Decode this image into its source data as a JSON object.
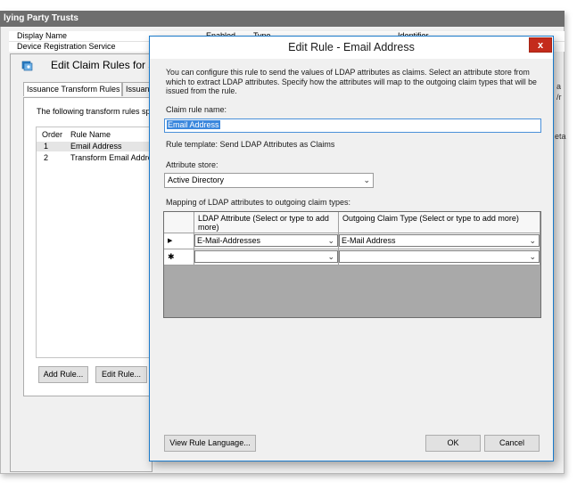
{
  "background_window": {
    "title": "lying Party Trusts",
    "columns": [
      "Display Name",
      "Enabled",
      "Type",
      "Identifier"
    ],
    "row": "Device Registration Service",
    "edge_texts": [
      "a",
      "/r",
      "eta"
    ]
  },
  "edit_claim_rules": {
    "title": "Edit Claim Rules for s",
    "tabs": [
      "Issuance Transform Rules",
      "Issuan"
    ],
    "description": "The following transform rules spec",
    "list_headers": [
      "Order",
      "Rule Name"
    ],
    "rows": [
      {
        "order": "1",
        "name": "Email Address"
      },
      {
        "order": "2",
        "name": "Transform Email Addres"
      }
    ],
    "add_rule_label": "Add Rule...",
    "edit_rule_label": "Edit Rule..."
  },
  "edit_rule": {
    "title": "Edit Rule - Email Address",
    "close_label": "x",
    "description": "You can configure this rule to send the values of LDAP attributes as claims. Select an attribute store from which to extract LDAP attributes. Specify how the attributes will map to the outgoing claim types that will be issued from the rule.",
    "claim_rule_name_label": "Claim rule name:",
    "claim_rule_name_value": "Email Address",
    "rule_template": "Rule template: Send LDAP Attributes as Claims",
    "attribute_store_label": "Attribute store:",
    "attribute_store_value": "Active Directory",
    "mapping_label": "Mapping of LDAP attributes to outgoing claim types:",
    "grid": {
      "header_ldap": "LDAP Attribute (Select or type to add more)",
      "header_claim": "Outgoing Claim Type (Select or type to add more)",
      "row1_marker": "▶",
      "row1_ldap": "E-Mail-Addresses",
      "row1_claim": "E-Mail Address",
      "row2_marker": "✱",
      "row2_ldap": "",
      "row2_claim": ""
    },
    "view_rule_language_label": "View Rule Language...",
    "ok_label": "OK",
    "cancel_label": "Cancel"
  },
  "icons": {
    "dropdown": "chevron-down-icon",
    "close": "close-icon",
    "claim_rules": "claim-rules-icon"
  },
  "colors": {
    "accent": "#1979ca",
    "close_red": "#c42b1c",
    "selection": "#3a87dd"
  }
}
